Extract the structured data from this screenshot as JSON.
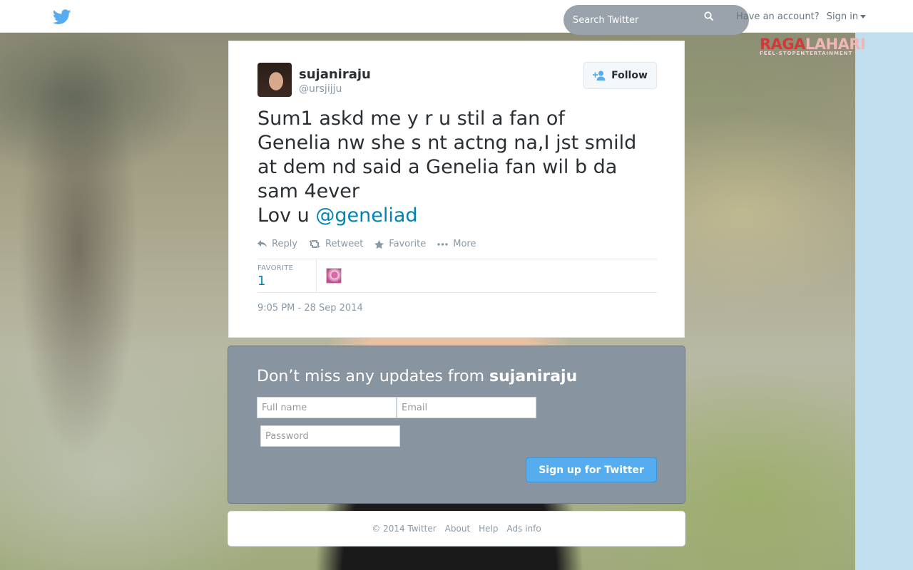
{
  "topbar": {
    "search_placeholder": "Search Twitter",
    "have_account": "Have an account?",
    "sign_in": "Sign in"
  },
  "watermark": {
    "part1": "RAGA",
    "part2": "LAHARI",
    "sub": "FEEL-STOPENTERTAINMENT"
  },
  "tweet": {
    "name": "sujaniraju",
    "handle": "@ursjijju",
    "follow_label": "Follow",
    "text_lines": [
      "Sum1 askd me y r u stil a fan of",
      "Genelia nw she s nt actng na,I jst smild",
      "at dem nd said a Genelia fan wil b da",
      "sam 4ever"
    ],
    "text_last_prefix": "Lov u ",
    "mention": "@geneliad",
    "actions": {
      "reply": "Reply",
      "retweet": "Retweet",
      "favorite": "Favorite",
      "more": "More"
    },
    "stats": {
      "label": "FAVORITE",
      "count": "1"
    },
    "timestamp": "9:05 PM - 28 Sep 2014"
  },
  "signup": {
    "heading_prefix": "Don’t miss any updates from ",
    "heading_name": "sujaniraju",
    "fullname_placeholder": "Full name",
    "email_placeholder": "Email",
    "password_placeholder": "Password",
    "button": "Sign up for Twitter"
  },
  "footer": {
    "copyright": "© 2014 Twitter",
    "about": "About",
    "help": "Help",
    "ads_info": "Ads info"
  },
  "colors": {
    "twitter_blue": "#55acee",
    "link": "#0084b4",
    "signup_bg": "#8894a0"
  }
}
